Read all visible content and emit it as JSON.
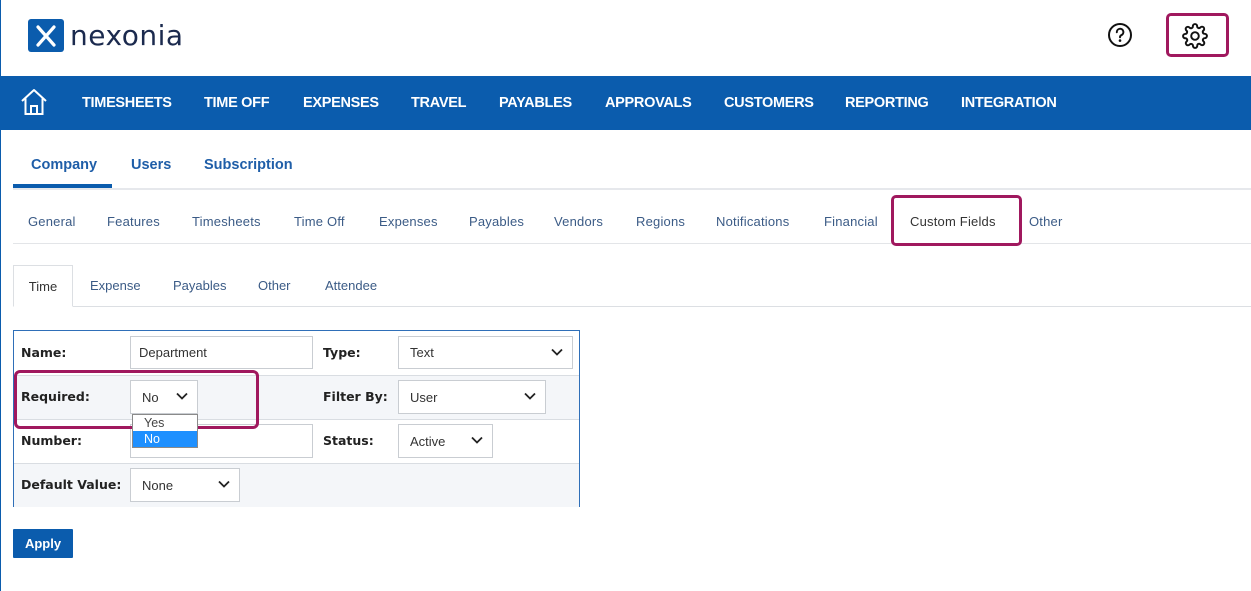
{
  "brand": {
    "name": "nexonia"
  },
  "header": {
    "help_icon": "question-circle-icon",
    "settings_icon": "gear-icon"
  },
  "main_nav": {
    "home_icon": "home-icon",
    "items": [
      "TIMESHEETS",
      "TIME OFF",
      "EXPENSES",
      "TRAVEL",
      "PAYABLES",
      "APPROVALS",
      "CUSTOMERS",
      "REPORTING",
      "INTEGRATION"
    ]
  },
  "settings_tabs": {
    "items": [
      "Company",
      "Users",
      "Subscription"
    ],
    "active": "Company"
  },
  "company_tabs": {
    "items": [
      "General",
      "Features",
      "Timesheets",
      "Time Off",
      "Expenses",
      "Payables",
      "Vendors",
      "Regions",
      "Notifications",
      "Financial",
      "Custom Fields",
      "Other"
    ],
    "active": "Custom Fields"
  },
  "custom_field_tabs": {
    "items": [
      "Time",
      "Expense",
      "Payables",
      "Other",
      "Attendee"
    ],
    "active": "Time"
  },
  "form": {
    "name_label": "Name:",
    "name_value": "Department",
    "type_label": "Type:",
    "type_value": "Text",
    "required_label": "Required:",
    "required_value": "No",
    "required_options": [
      "Yes",
      "No"
    ],
    "filter_label": "Filter By:",
    "filter_value": "User",
    "number_label": "Number:",
    "number_value": "",
    "status_label": "Status:",
    "status_value": "Active",
    "default_label": "Default Value:",
    "default_value": "None"
  },
  "apply_label": "Apply",
  "colors": {
    "brand_blue": "#0b5cad",
    "highlight": "#a0185e",
    "selected_option": "#1e90ff"
  }
}
